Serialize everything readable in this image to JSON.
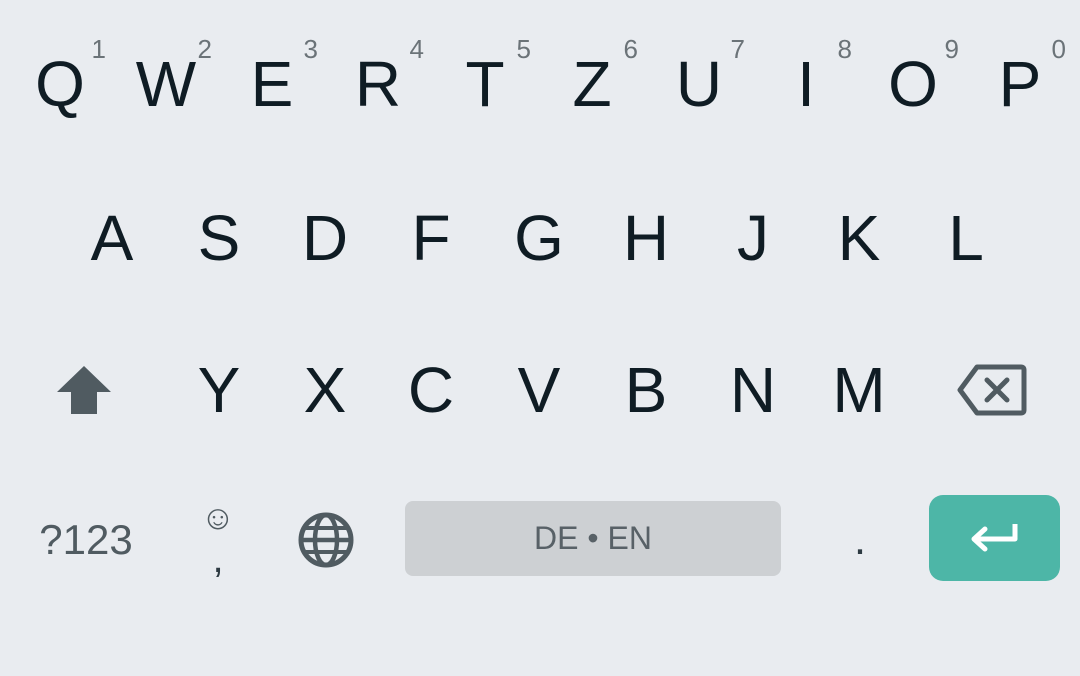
{
  "keyboard": {
    "row1": [
      {
        "letter": "Q",
        "hint": "1"
      },
      {
        "letter": "W",
        "hint": "2"
      },
      {
        "letter": "E",
        "hint": "3"
      },
      {
        "letter": "R",
        "hint": "4"
      },
      {
        "letter": "T",
        "hint": "5"
      },
      {
        "letter": "Z",
        "hint": "6"
      },
      {
        "letter": "U",
        "hint": "7"
      },
      {
        "letter": "I",
        "hint": "8"
      },
      {
        "letter": "O",
        "hint": "9"
      },
      {
        "letter": "P",
        "hint": "0"
      }
    ],
    "row2": [
      "A",
      "S",
      "D",
      "F",
      "G",
      "H",
      "J",
      "K",
      "L"
    ],
    "row3": [
      "Y",
      "X",
      "C",
      "V",
      "B",
      "N",
      "M"
    ],
    "bottom": {
      "symbols_label": "?123",
      "emoji_symbol": "☺",
      "comma": ",",
      "space_label": "DE • EN",
      "period": "."
    },
    "icons": {
      "shift": "shift-icon",
      "delete": "backspace-icon",
      "globe": "globe-icon",
      "enter": "enter-icon"
    },
    "colors": {
      "background": "#e9ecf0",
      "key_text": "#0f1c24",
      "hint_text": "#6b7378",
      "space_bar": "#cdd0d3",
      "enter": "#4db6a7",
      "icon": "#505b61"
    }
  }
}
